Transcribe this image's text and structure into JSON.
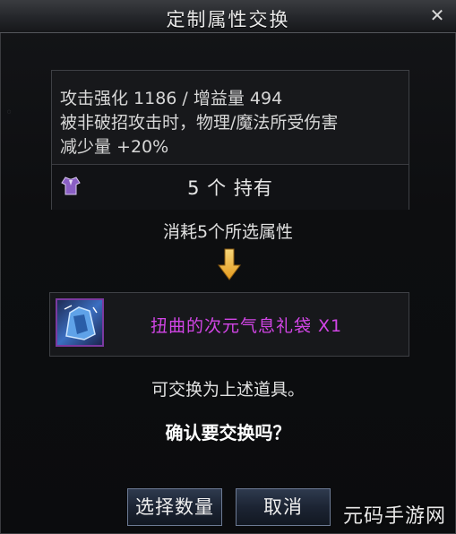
{
  "window": {
    "title": "定制属性交换",
    "close_label": "✕"
  },
  "info": {
    "line1": "攻击强化 1186 / 增益量 494",
    "line2": "被非破招攻击时，物理/魔法所受伤害",
    "line3": "减少量 +20%"
  },
  "owned": {
    "count_text": "5 个 持有",
    "icon": "armor-icon"
  },
  "consume_text": "消耗5个所选属性",
  "reward": {
    "name": "扭曲的次元气息礼袋 X1",
    "icon": "gift-bag-icon"
  },
  "exchangeable_text": "可交换为上述道具。",
  "confirm_text": "确认要交换吗？",
  "buttons": {
    "select_qty": "选择数量",
    "cancel": "取消"
  },
  "watermark": "元码手游网",
  "colors": {
    "reward_name": "#d245e6",
    "arrow": "#f2b437"
  }
}
